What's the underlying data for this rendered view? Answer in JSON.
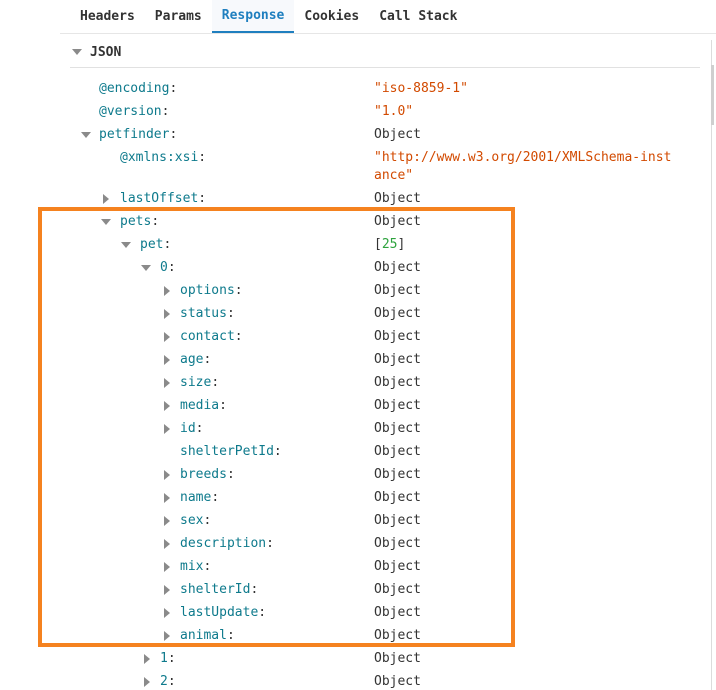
{
  "tabs": [
    {
      "label": "Headers",
      "active": false
    },
    {
      "label": "Params",
      "active": false
    },
    {
      "label": "Response",
      "active": true
    },
    {
      "label": "Cookies",
      "active": false
    },
    {
      "label": "Call Stack",
      "active": false
    }
  ],
  "section": {
    "title": "JSON"
  },
  "tree": {
    "encoding": {
      "key": "@encoding",
      "value": "\"iso-8859-1\""
    },
    "version": {
      "key": "@version",
      "value": "\"1.0\""
    },
    "petfinder": {
      "key": "petfinder",
      "value": "Object"
    },
    "xmlns": {
      "key": "@xmlns:xsi",
      "value_line1": "\"http://www.w3.org/2001/XMLSchema-inst",
      "value_line2": "ance\""
    },
    "lastOffset": {
      "key": "lastOffset",
      "value": "Object"
    },
    "pets": {
      "key": "pets",
      "value": "Object"
    },
    "pet": {
      "key": "pet",
      "value_open": "[",
      "value_count": "25",
      "value_close": "]"
    },
    "item0": {
      "key": "0",
      "value": "Object"
    },
    "fields": [
      {
        "key": "options",
        "value": "Object",
        "expandable": true
      },
      {
        "key": "status",
        "value": "Object",
        "expandable": true
      },
      {
        "key": "contact",
        "value": "Object",
        "expandable": true
      },
      {
        "key": "age",
        "value": "Object",
        "expandable": true
      },
      {
        "key": "size",
        "value": "Object",
        "expandable": true
      },
      {
        "key": "media",
        "value": "Object",
        "expandable": true
      },
      {
        "key": "id",
        "value": "Object",
        "expandable": true
      },
      {
        "key": "shelterPetId",
        "value": "Object",
        "expandable": false
      },
      {
        "key": "breeds",
        "value": "Object",
        "expandable": true
      },
      {
        "key": "name",
        "value": "Object",
        "expandable": true
      },
      {
        "key": "sex",
        "value": "Object",
        "expandable": true
      },
      {
        "key": "description",
        "value": "Object",
        "expandable": true
      },
      {
        "key": "mix",
        "value": "Object",
        "expandable": true
      },
      {
        "key": "shelterId",
        "value": "Object",
        "expandable": true
      },
      {
        "key": "lastUpdate",
        "value": "Object",
        "expandable": true
      },
      {
        "key": "animal",
        "value": "Object",
        "expandable": true
      }
    ],
    "item1": {
      "key": "1",
      "value": "Object"
    },
    "item2": {
      "key": "2",
      "value": "Object"
    }
  },
  "colors": {
    "accent": "#1f7fbf",
    "key": "#0e7a8c",
    "string": "#d24a00",
    "number": "#2da33d",
    "highlight": "#f5821f"
  }
}
